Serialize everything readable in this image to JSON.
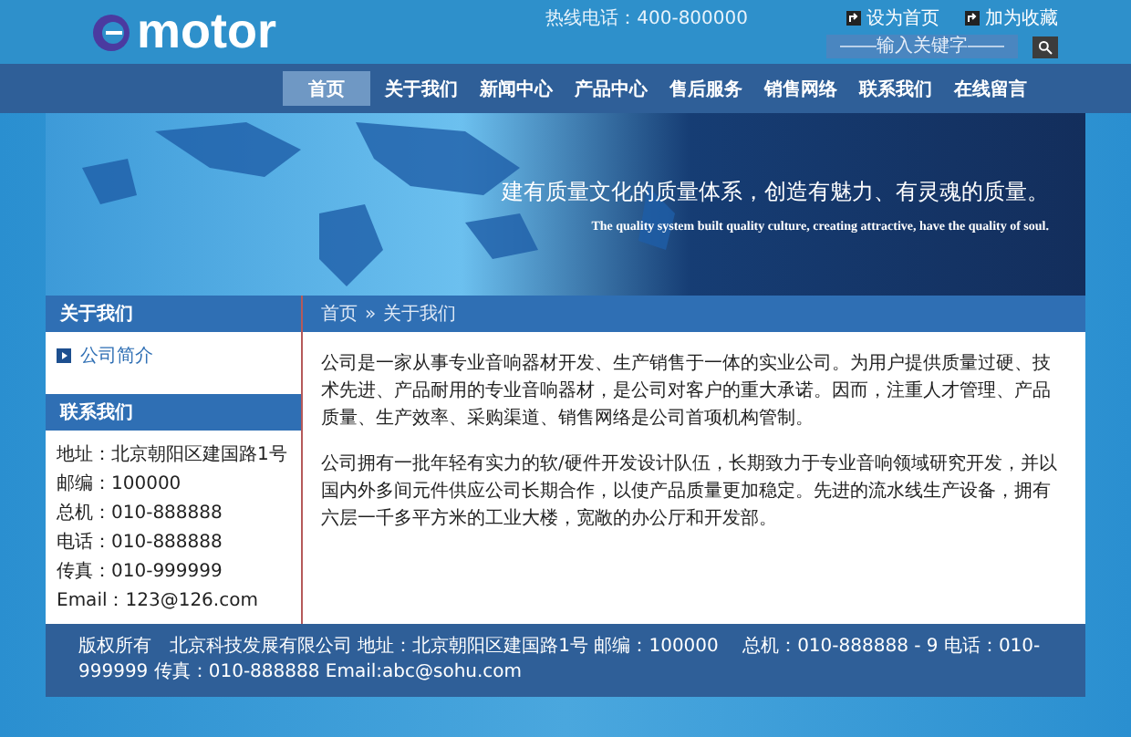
{
  "header": {
    "logo": "motor",
    "hotline": "热线电话：400-800000",
    "links": [
      {
        "label": "设为首页"
      },
      {
        "label": "加为收藏"
      }
    ],
    "search": {
      "placeholder": "——输入关键字——"
    }
  },
  "nav": [
    {
      "label": "首页",
      "selected": true
    },
    {
      "label": "关于我们",
      "selected": false
    },
    {
      "label": "新闻中心",
      "selected": false
    },
    {
      "label": "产品中心",
      "selected": false
    },
    {
      "label": "售后服务",
      "selected": false
    },
    {
      "label": "销售网络",
      "selected": false
    },
    {
      "label": "联系我们",
      "selected": false
    },
    {
      "label": "在线留言",
      "selected": false
    }
  ],
  "banner": {
    "slogan": "建有质量文化的质量体系，创造有魅力、有灵魂的质量。",
    "subtitle": "The quality system built quality culture, creating attractive, have the quality of soul."
  },
  "sidebar": {
    "about_title": "关于我们",
    "about_items": [
      {
        "label": "公司简介"
      }
    ],
    "contact_title": "联系我们",
    "contact_lines": [
      "地址：北京朝阳区建国路1号",
      "邮编：100000",
      "总机：010-888888",
      "电话：010-888888",
      "传真：010-999999",
      "Email：123@126.com"
    ]
  },
  "breadcrumb": [
    "首页",
    "»",
    "关于我们"
  ],
  "content": [
    "公司是一家从事专业音响器材开发、生产销售于一体的实业公司。为用户提供质量过硬、技术先进、产品耐用的专业音响器材，是公司对客户的重大承诺。因而，注重人才管理、产品质量、生产效率、采购渠道、销售网络是公司首项机构管制。",
    "公司拥有一批年轻有实力的软/硬件开发设计队伍，长期致力于专业音响领域研究开发，并以国内外多间元件供应公司长期合作，以使产品质量更加稳定。先进的流水线生产设备，拥有六层一千多平方米的工业大楼，宽敞的办公厅和开发部。"
  ],
  "footer": "版权所有　北京科技发展有限公司 地址：北京朝阳区建国路1号 邮编：100000　 总机：010-888888 - 9 电话：010-999999 传真：010-888888 Email:abc@sohu.com"
}
